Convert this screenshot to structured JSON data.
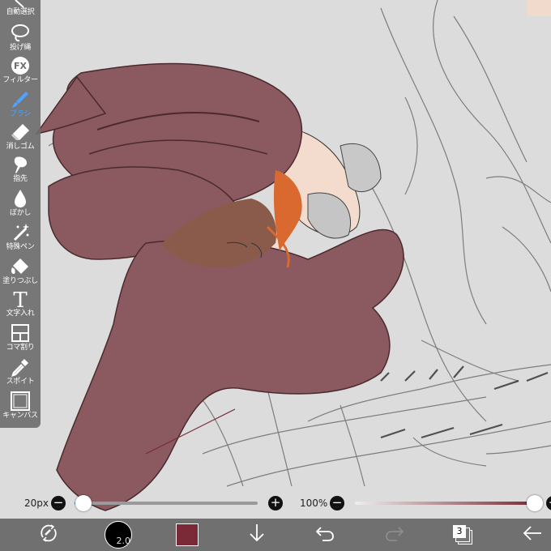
{
  "toolbar": {
    "items": [
      {
        "label": "自動選択",
        "icon": "magic-wand-icon"
      },
      {
        "label": "投げ縄",
        "icon": "lasso-icon"
      },
      {
        "label": "フィルター",
        "icon": "fx-icon",
        "icon_text": "FX"
      },
      {
        "label": "ブラシ",
        "icon": "brush-icon",
        "active": true
      },
      {
        "label": "消しゴム",
        "icon": "eraser-icon"
      },
      {
        "label": "指先",
        "icon": "finger-smudge-icon"
      },
      {
        "label": "ぼかし",
        "icon": "blur-drop-icon"
      },
      {
        "label": "特殊ペン",
        "icon": "special-pen-icon"
      },
      {
        "label": "塗りつぶし",
        "icon": "bucket-fill-icon"
      },
      {
        "label": "文字入れ",
        "icon": "text-tool-icon",
        "icon_text": "T"
      },
      {
        "label": "コマ割り",
        "icon": "panel-divide-icon"
      },
      {
        "label": "スポイト",
        "icon": "eyedropper-icon"
      },
      {
        "label": "キャンバス",
        "icon": "canvas-icon"
      }
    ],
    "active_color": "#4ea3ff"
  },
  "brush_size": {
    "value_label": "20px",
    "level": 0.05
  },
  "opacity": {
    "value_label": "100%",
    "level": 1.0
  },
  "bottom": {
    "brush_size_badge": "2.0",
    "current_color": "#7a2a36",
    "layer_count": "3"
  }
}
